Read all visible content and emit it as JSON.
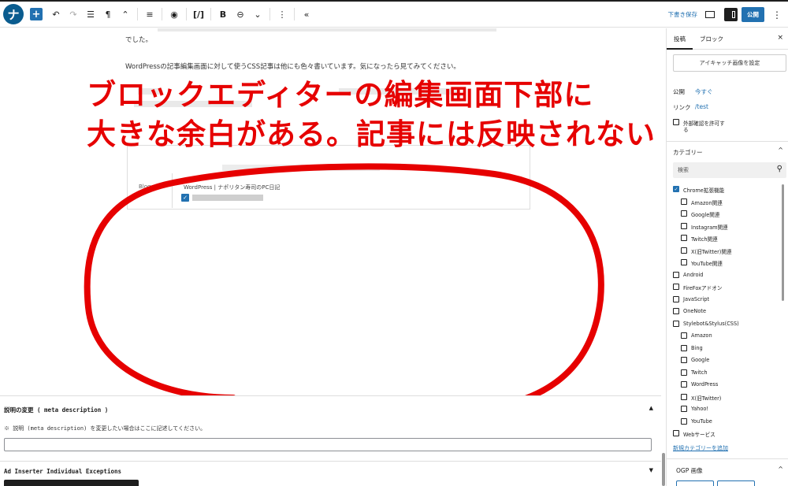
{
  "toolbar": {
    "logo_letter": "ナ",
    "add": "+",
    "undo": "↶",
    "redo": "↷",
    "list_view": "☰",
    "paragraph": "¶",
    "move": "⌃",
    "align": "≡",
    "preview_eye": "◉",
    "code": "[/]",
    "bold": "B",
    "link": "⊖",
    "more_dd": "⌄",
    "options": "⋮",
    "collapse": "«",
    "save_draft": "下書き保存",
    "publish": "公開",
    "more": "⋮"
  },
  "content": {
    "para1": "でした。",
    "para2": "WordPressの記事編集画面に対して使うCSS記事は他にも色々書いています。気になったら見てみてください。",
    "blogcard_label": "Blogcard",
    "blogcard_site": "WordPress | ナポリタン寿司のPC日記"
  },
  "annotation": {
    "line1": "ブロックエディターの編集画面下部に",
    "line2": "大きな余白がある。記事には反映されない",
    "color": "#e60000"
  },
  "meta_box": {
    "title": "説明の変更 ( meta description )",
    "toggle": "▲",
    "help": "※ 説明 (meta description) を変更したい場合はここに記述してください。"
  },
  "ad_box": {
    "title": "Ad Inserter Individual Exceptions",
    "toggle": "▼"
  },
  "sidebar": {
    "tab_post": "投稿",
    "tab_block": "ブロック",
    "close": "×",
    "eyecatch": "アイキャッチ画像を設定",
    "publish_label": "公開",
    "publish_value": "今すぐ",
    "link_label": "リンク",
    "link_value": "/test",
    "ping_line1": "外部確認を許可す",
    "ping_line2": "る",
    "categories_title": "カテゴリー",
    "categories_chevron": "^",
    "search_placeholder": "検索",
    "search_icon": "⚲",
    "categories": [
      {
        "label": "Chrome拡張機能",
        "checked": true,
        "child": false
      },
      {
        "label": "Amazon関連",
        "checked": false,
        "child": true
      },
      {
        "label": "Google関連",
        "checked": false,
        "child": true
      },
      {
        "label": "Instagram関連",
        "checked": false,
        "child": true
      },
      {
        "label": "Twitch関連",
        "checked": false,
        "child": true
      },
      {
        "label": "X(旧Twitter)関連",
        "checked": false,
        "child": true
      },
      {
        "label": "YouTube関連",
        "checked": false,
        "child": true
      },
      {
        "label": "Android",
        "checked": false,
        "child": false
      },
      {
        "label": "FireFoxアドオン",
        "checked": false,
        "child": false
      },
      {
        "label": "JavaScript",
        "checked": false,
        "child": false
      },
      {
        "label": "OneNote",
        "checked": false,
        "child": false
      },
      {
        "label": "Stylebot&Stylus(CSS)",
        "checked": false,
        "child": false
      },
      {
        "label": "Amazon",
        "checked": false,
        "child": true
      },
      {
        "label": "Bing",
        "checked": false,
        "child": true
      },
      {
        "label": "Google",
        "checked": false,
        "child": true
      },
      {
        "label": "Twitch",
        "checked": false,
        "child": true
      },
      {
        "label": "WordPress",
        "checked": false,
        "child": true
      },
      {
        "label": "X(旧Twitter)",
        "checked": false,
        "child": true
      },
      {
        "label": "Yahoo!",
        "checked": false,
        "child": true
      },
      {
        "label": "YouTube",
        "checked": false,
        "child": true
      },
      {
        "label": "Webサービス",
        "checked": false,
        "child": false
      }
    ],
    "add_category": "新規カテゴリーを追加",
    "ogp_title": "OGP 画像",
    "ogp_chevron": "^"
  }
}
